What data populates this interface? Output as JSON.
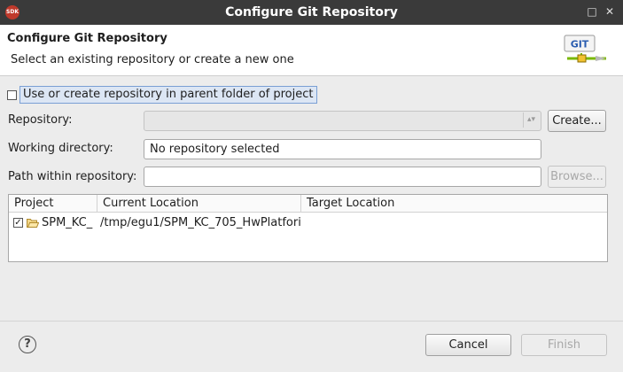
{
  "window": {
    "title": "Configure Git Repository",
    "app_badge": "SDK",
    "minimize_glyph": "□",
    "close_glyph": "✕"
  },
  "header": {
    "title": "Configure Git Repository",
    "description": "Select an existing repository or create a new one",
    "logo_text": "GIT"
  },
  "parent_option": {
    "label": "Use or create repository in parent folder of project",
    "checked": false
  },
  "form": {
    "repository_label": "Repository:",
    "repository_value": "",
    "create_button": "Create...",
    "working_dir_label": "Working directory:",
    "working_dir_value": "No repository selected",
    "path_label": "Path within repository:",
    "path_value": "",
    "browse_button": "Browse..."
  },
  "table": {
    "columns": [
      "Project",
      "Current Location",
      "Target Location"
    ],
    "rows": [
      {
        "checked": true,
        "project": "SPM_KC_",
        "current_location": "/tmp/egu1/SPM_KC_705_HwPlatfori",
        "target_location": ""
      }
    ]
  },
  "footer": {
    "help_glyph": "?",
    "cancel_button": "Cancel",
    "finish_button": "Finish"
  },
  "colors": {
    "titlebar": "#3a3a3a",
    "selection_highlight": "#dce6f4",
    "git_green": "#7ab800"
  }
}
